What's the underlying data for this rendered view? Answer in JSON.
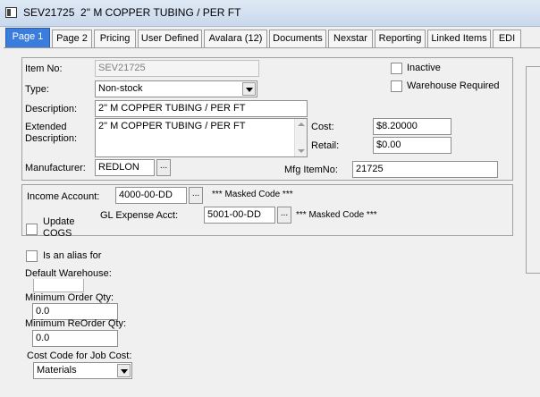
{
  "window": {
    "title": "SEV21725  2\" M COPPER TUBING / PER FT"
  },
  "tabs": [
    {
      "label": "Page 1"
    },
    {
      "label": "Page 2"
    },
    {
      "label": "Pricing"
    },
    {
      "label": "User Defined"
    },
    {
      "label": "Avalara (12)"
    },
    {
      "label": "Documents"
    },
    {
      "label": "Nexstar"
    },
    {
      "label": "Reporting"
    },
    {
      "label": "Linked Items"
    },
    {
      "label": "EDI"
    }
  ],
  "item": {
    "item_no_label": "Item No:",
    "item_no": "SEV21725",
    "type_label": "Type:",
    "type": "Non-stock",
    "description_label": "Description:",
    "description": "2\" M COPPER TUBING / PER FT",
    "extended_label_1": "Extended",
    "extended_label_2": "Description:",
    "extended_description": "2\" M COPPER TUBING / PER FT",
    "manufacturer_label": "Manufacturer:",
    "manufacturer": "REDLON",
    "inactive_label": "Inactive",
    "warehouse_required_label": "Warehouse Required",
    "cost_label": "Cost:",
    "cost": "$8.20000",
    "retail_label": "Retail:",
    "retail": "$0.00",
    "mfg_itemno_label": "Mfg ItemNo:",
    "mfg_itemno": "21725"
  },
  "accounts": {
    "income_label": "Income Account:",
    "income_account": "4000-00-DD",
    "masked_code": "*** Masked Code ***",
    "gl_expense_label": "GL Expense Acct:",
    "gl_expense_account": "5001-00-DD",
    "update_cogs_label_1": "Update",
    "update_cogs_label_2": "COGS"
  },
  "misc": {
    "alias_label": "Is an alias for",
    "default_warehouse_label": "Default Warehouse:",
    "default_warehouse": "",
    "min_order_label": "Minimum Order Qty:",
    "min_order_qty": "0.0",
    "min_reorder_label": "Minimum ReOrder Qty:",
    "min_reorder_qty": "0.0",
    "cost_code_label": "Cost Code for Job Cost:",
    "cost_code": "Materials"
  },
  "ellipsis": "..."
}
